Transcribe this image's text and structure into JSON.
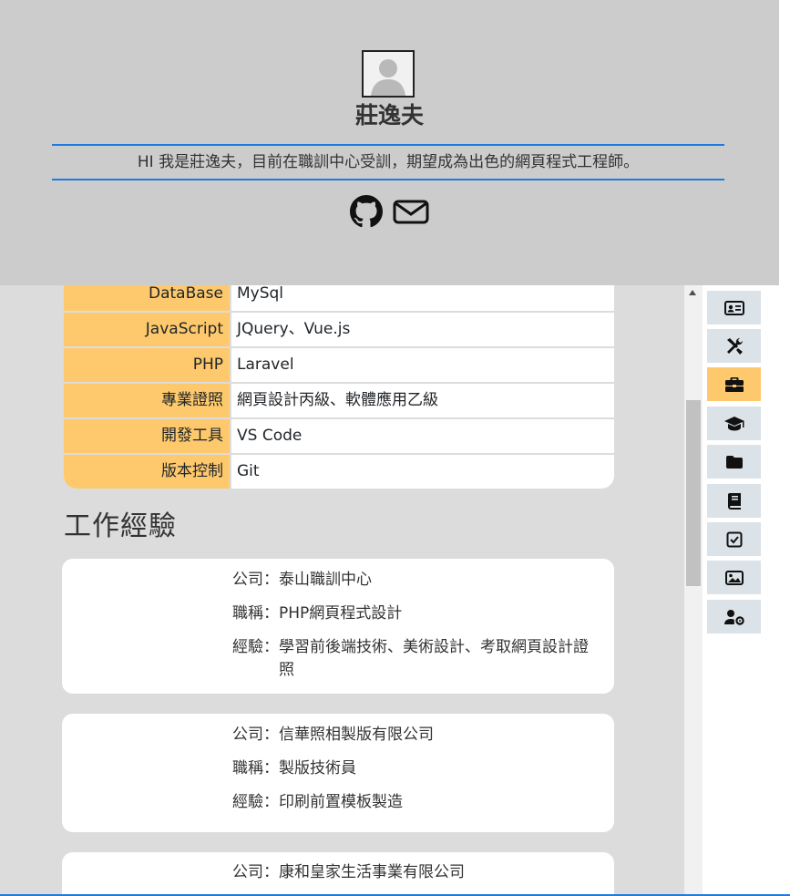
{
  "profile": {
    "name": "莊逸夫",
    "intro": "HI 我是莊逸夫，目前在職訓中心受訓，期望成為出色的網頁程式工程師。",
    "social": [
      "github-icon",
      "mail-icon"
    ]
  },
  "skills": [
    {
      "key": "DataBase",
      "value": "MySql"
    },
    {
      "key": "JavaScript",
      "value": "JQuery、Vue.js"
    },
    {
      "key": "PHP",
      "value": "Laravel"
    },
    {
      "key": "專業證照",
      "value": "網頁設計丙級、軟體應用乙級"
    },
    {
      "key": "開發工具",
      "value": "VS Code"
    },
    {
      "key": "版本控制",
      "value": "Git"
    }
  ],
  "work": {
    "heading": "工作經驗",
    "jobs": [
      {
        "company_label": "公司：",
        "company": "泰山職訓中心",
        "title_label": "職稱：",
        "title": "PHP網頁程式設計",
        "exp_label": "經驗：",
        "experience": "學習前後端技術、美術設計、考取網頁設計證照"
      },
      {
        "company_label": "公司：",
        "company": "信華照相製版有限公司",
        "title_label": "職稱：",
        "title": "製版技術員",
        "exp_label": "經驗：",
        "experience": "印刷前置模板製造"
      },
      {
        "company_label": "公司：",
        "company": "康和皇家生活事業有限公司"
      }
    ]
  },
  "sidenav": {
    "items": [
      "id-card-icon",
      "tools-icon",
      "briefcase-icon",
      "graduation-cap-icon",
      "folder-icon",
      "book-icon",
      "check-square-icon",
      "image-icon",
      "user-cog-icon"
    ],
    "active": "briefcase-icon",
    "active_color": "#fec96d"
  },
  "colors": {
    "accent": "#1e7be0",
    "highlight": "#fec96d",
    "header_bg": "#cccccc",
    "content_bg": "#dcdcdc"
  }
}
